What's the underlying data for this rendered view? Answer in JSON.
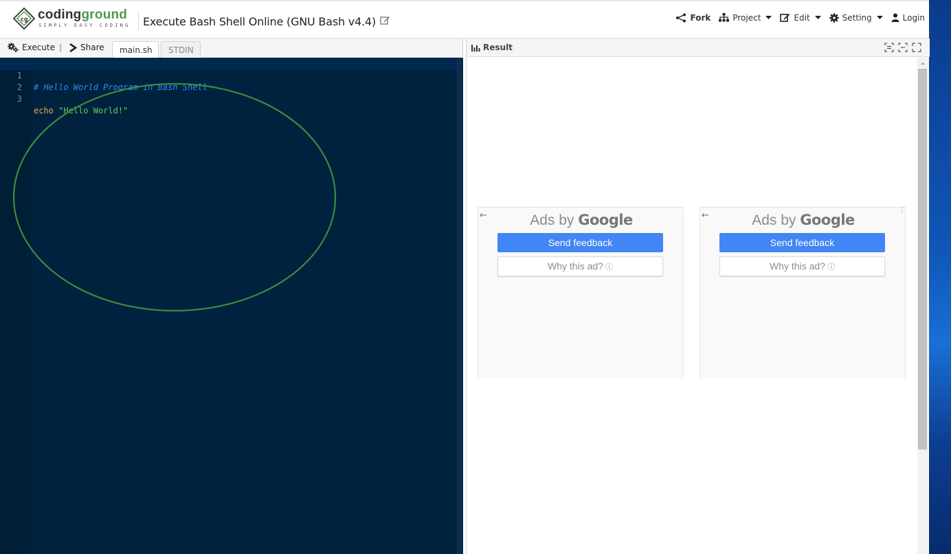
{
  "brand": {
    "name_part1": "coding",
    "name_part2": "ground",
    "tagline": "SIMPLY EASY CODING"
  },
  "page": {
    "title": "Execute Bash Shell Online (GNU Bash v4.4)"
  },
  "nav": {
    "fork": "Fork",
    "project": "Project",
    "edit": "Edit",
    "setting": "Setting",
    "login": "Login"
  },
  "toolbar": {
    "execute": "Execute",
    "separator": "|",
    "share": "Share"
  },
  "tabs": [
    {
      "label": "main.sh",
      "active": true
    },
    {
      "label": "STDIN",
      "active": false
    }
  ],
  "editor": {
    "lines": [
      {
        "number": "1",
        "tokens": [
          {
            "type": "comment",
            "text": "# Hello World Program in Bash Shell"
          }
        ]
      },
      {
        "number": "2",
        "tokens": []
      },
      {
        "number": "3",
        "tokens": [
          {
            "type": "cmd",
            "text": "echo"
          },
          {
            "type": "plain",
            "text": " "
          },
          {
            "type": "str",
            "text": "\"Hello World!\""
          }
        ]
      }
    ]
  },
  "result": {
    "title": "Result"
  },
  "ads": [
    {
      "ads_by": "Ads by ",
      "google": "Google",
      "back": "←",
      "feedback": "Send feedback",
      "why": "Why this ad?",
      "info": "ⓘ"
    },
    {
      "ads_by": "Ads by ",
      "google": "Google",
      "back": "←",
      "feedback": "Send feedback",
      "why": "Why this ad?",
      "info": "ⓘ"
    }
  ],
  "colors": {
    "editor_bg": "#00223f",
    "comment": "#2d8cf0",
    "command": "#f0a844",
    "string": "#5ad05a",
    "ad_button": "#4285f4",
    "annotation": "#3c8c3c"
  },
  "icons": {
    "execute": "gears-icon",
    "share": "chevron-right-icon",
    "fork": "share-nodes-icon",
    "project": "sitemap-icon",
    "edit": "edit-icon",
    "setting": "gear-icon",
    "login": "user-icon",
    "result": "bar-chart-icon"
  }
}
